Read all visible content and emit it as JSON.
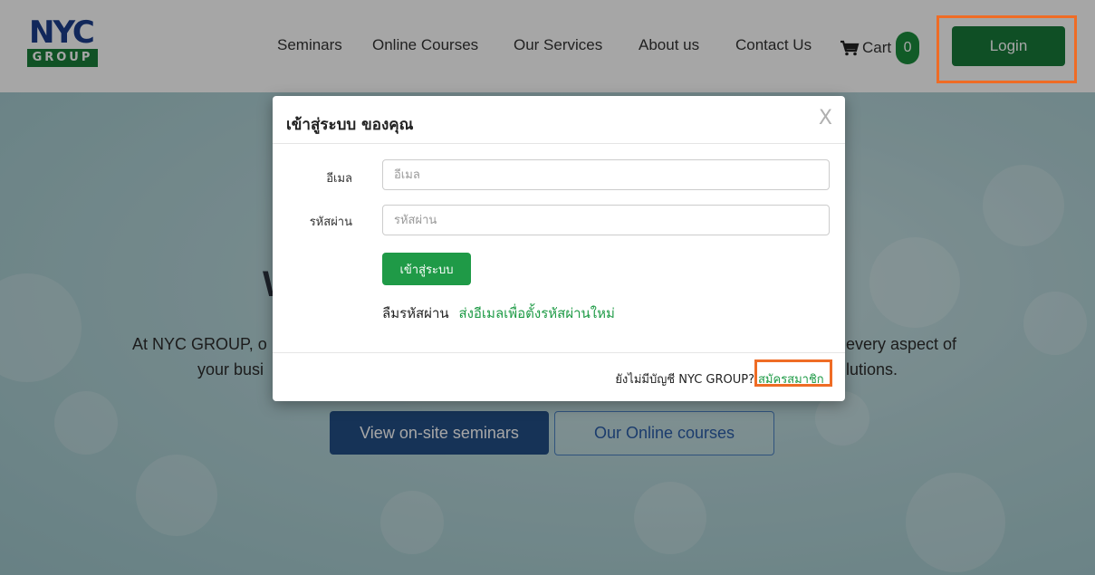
{
  "header": {
    "logo_top": "NYC",
    "logo_bottom": "GROUP",
    "nav": [
      "Seminars",
      "Online Courses",
      "Our Services",
      "About us",
      "Contact Us"
    ],
    "cart_label": "Cart",
    "cart_count": "0",
    "login_label": "Login"
  },
  "hero": {
    "headline_fragment": "W",
    "line1_left": "At NYC GROUP, o",
    "line1_right": "every aspect of",
    "line2_left": "your busi",
    "line2_right": "lutions.",
    "seminars_button": "View on-site seminars",
    "courses_button": "Our Online courses"
  },
  "modal": {
    "title": "เข้าสู่ระบบ ของคุณ",
    "close_glyph": "X",
    "email_label": "อีเมล",
    "email_placeholder": "อีเมล",
    "password_label": "รหัสผ่าน",
    "password_placeholder": "รหัสผ่าน",
    "submit_label": "เข้าสู่ระบบ",
    "forgot_text": "ลืมรหัสผ่าน",
    "forgot_link": "ส่งอีเมลเพื่อตั้งรหัสผ่านใหม่",
    "no_account_text": "ยังไม่มีบัญชี NYC GROUP?",
    "register_link": "สมัครสมาชิก"
  },
  "colors": {
    "brand_green": "#177a39",
    "brand_blue": "#1c3e8c",
    "highlight_orange": "#ef6c25"
  }
}
